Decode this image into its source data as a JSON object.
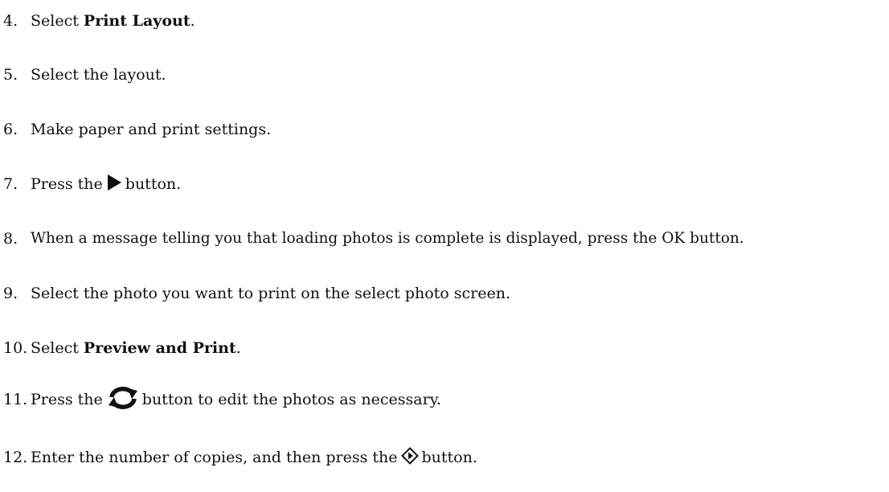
{
  "steps": [
    {
      "number": "4.",
      "before": "Select ",
      "bold": "Print Layout",
      "after": "."
    },
    {
      "number": "5.",
      "text": "Select the layout."
    },
    {
      "number": "6.",
      "text": "Make paper and print settings."
    },
    {
      "number": "7.",
      "before": "Press the",
      "icon": "play-triangle-icon",
      "after": "button."
    },
    {
      "number": "8.",
      "text": "When a message telling you that loading photos is complete is displayed, press the OK button."
    },
    {
      "number": "9.",
      "text": "Select the photo you want to print on the select photo screen."
    },
    {
      "number": "10.",
      "before": "Select ",
      "bold": "Preview and Print",
      "after": "."
    },
    {
      "number": "11.",
      "before": "Press the",
      "icon": "rotate-cycle-icon",
      "after": "button to edit the photos as necessary."
    },
    {
      "number": "12.",
      "before": "Enter the number of copies, and then press the",
      "icon": "start-diamond-icon",
      "after": "button."
    }
  ]
}
